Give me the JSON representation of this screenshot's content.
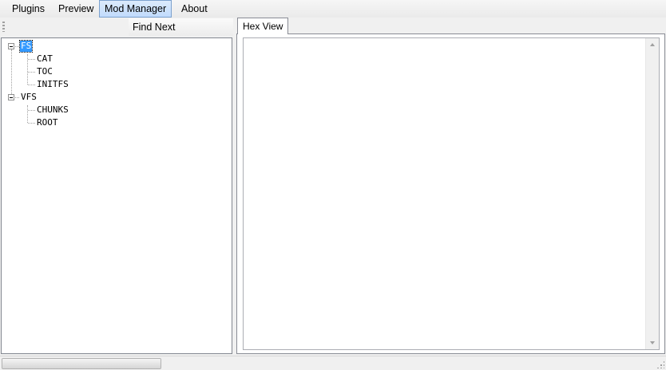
{
  "menu": {
    "items": [
      {
        "label": "Plugins"
      },
      {
        "label": "Preview"
      },
      {
        "label": "Mod Manager"
      },
      {
        "label": "About"
      }
    ]
  },
  "toolbar": {
    "find_next_label": "Find Next"
  },
  "tree": {
    "nodes": [
      {
        "label": "FS",
        "selected": true
      },
      {
        "label": "CAT"
      },
      {
        "label": "TOC"
      },
      {
        "label": "INITFS"
      },
      {
        "label": "VFS"
      },
      {
        "label": "CHUNKS"
      },
      {
        "label": "ROOT"
      }
    ]
  },
  "tabs": [
    {
      "label": "Hex View"
    }
  ],
  "statusbar": {
    "progress_fraction": 1.0
  }
}
